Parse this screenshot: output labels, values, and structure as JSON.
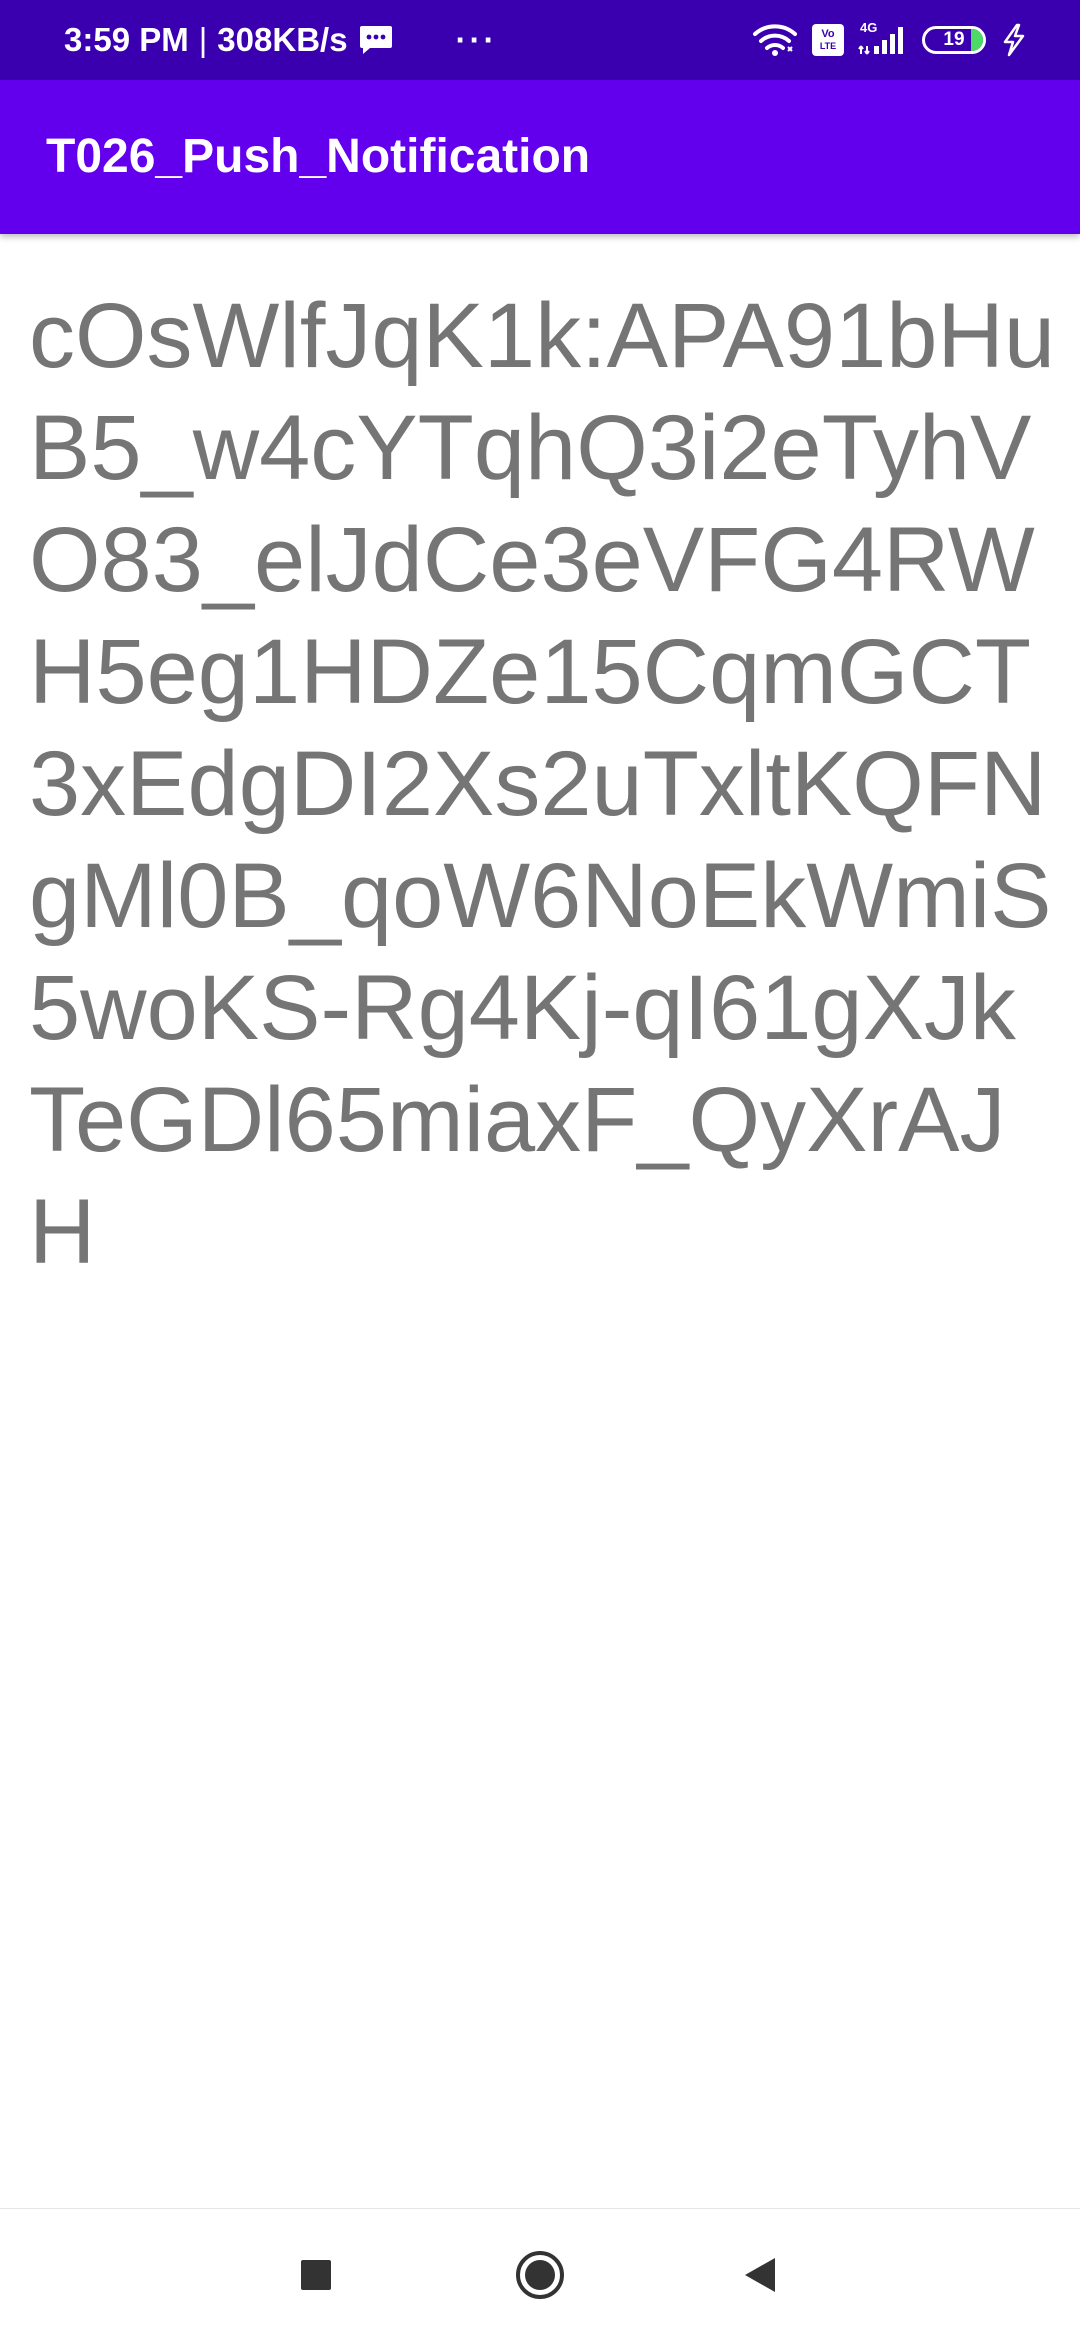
{
  "status_bar": {
    "time": "3:59 PM",
    "separator": "|",
    "network_speed": "308KB/s",
    "overflow_dots": "···",
    "volte_top": "Vo",
    "volte_bottom": "LTE",
    "network_type": "4G",
    "battery_percent": "19",
    "icons": [
      "message-icon",
      "wifi-icon",
      "volte-icon",
      "signal-icon",
      "battery-icon",
      "charging-icon"
    ]
  },
  "app_bar": {
    "title": "T026_Push_Notification"
  },
  "content": {
    "token": "cOsWlfJqK1k:APA91bHuB5_w4cYTqhQ3i2eTyhVO83_elJdCe3eVFG4RWH5eg1HDZe15CqmGCT3xEdgDI2Xs2uTxltKQFNgMl0B_qoW6NoEkWmiS5woKS-Rg4Kj-qI61gXJkTeGDl65miaxF_QyXrAJH"
  },
  "nav_bar": {
    "icons": [
      "recents-icon",
      "home-icon",
      "back-icon"
    ]
  },
  "colors": {
    "status_bar": "#3a00b0",
    "app_bar": "#6200ee",
    "token_text": "#757575",
    "nav_icon": "#333333"
  }
}
